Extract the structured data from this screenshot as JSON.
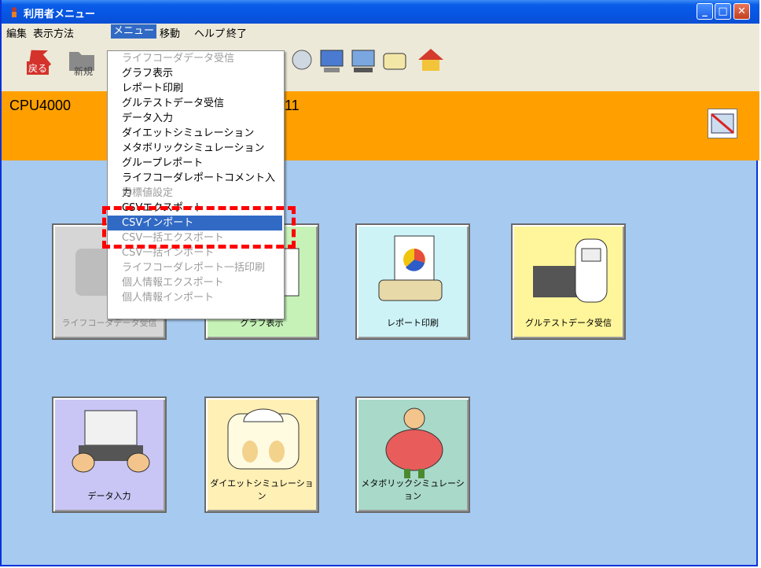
{
  "window": {
    "title": "利用者メニュー"
  },
  "menubar": [
    "編集",
    "表示方法",
    "メニュー",
    "移動",
    "ヘルプ",
    "終了"
  ],
  "toolbar": {
    "back_label": "戻る",
    "new_label": "新規"
  },
  "user": {
    "id_prefix": "CPU4000",
    "id_suffix": "11"
  },
  "dropdown": {
    "items": [
      {
        "label": "ライフコーダデータ受信",
        "state": "disabled"
      },
      {
        "label": "グラフ表示",
        "state": "enabled"
      },
      {
        "label": "レポート印刷",
        "state": "enabled"
      },
      {
        "label": "グルテストデータ受信",
        "state": "enabled"
      },
      {
        "label": "データ入力",
        "state": "enabled"
      },
      {
        "label": "ダイエットシミュレーション",
        "state": "enabled"
      },
      {
        "label": "メタボリックシミュレーション",
        "state": "enabled"
      },
      {
        "label": "グループレポート",
        "state": "enabled"
      },
      {
        "label": "ライフコーダレポートコメント入力",
        "state": "enabled"
      },
      {
        "label": "目標値設定",
        "state": "disabled"
      },
      {
        "label": "CSVエクスポート",
        "state": "enabled"
      },
      {
        "label": "CSVインポート",
        "state": "selected"
      },
      {
        "label": "CSV一括エクスポート",
        "state": "disabled"
      },
      {
        "label": "CSV一括インポート",
        "state": "disabled"
      },
      {
        "label": "ライフコーダレポート一括印刷",
        "state": "disabled"
      },
      {
        "label": "個人情報エクスポート",
        "state": "disabled"
      },
      {
        "label": "個人情報インポート",
        "state": "disabled"
      }
    ]
  },
  "tiles": {
    "lifecorder": "ライフコーダデータ受信",
    "graph": "グラフ表示",
    "report": "レポート印刷",
    "glutest": "グルテストデータ受信",
    "data_input": "データ入力",
    "diet": "ダイエットシミュレーション",
    "metabo": "メタボリックシミュレーション"
  },
  "colors": {
    "title_bar": "#0a5ee8",
    "user_bar": "#ffa000",
    "background": "#a6caf0",
    "menu_selected": "#316ac5",
    "highlight": "#ff0000"
  }
}
